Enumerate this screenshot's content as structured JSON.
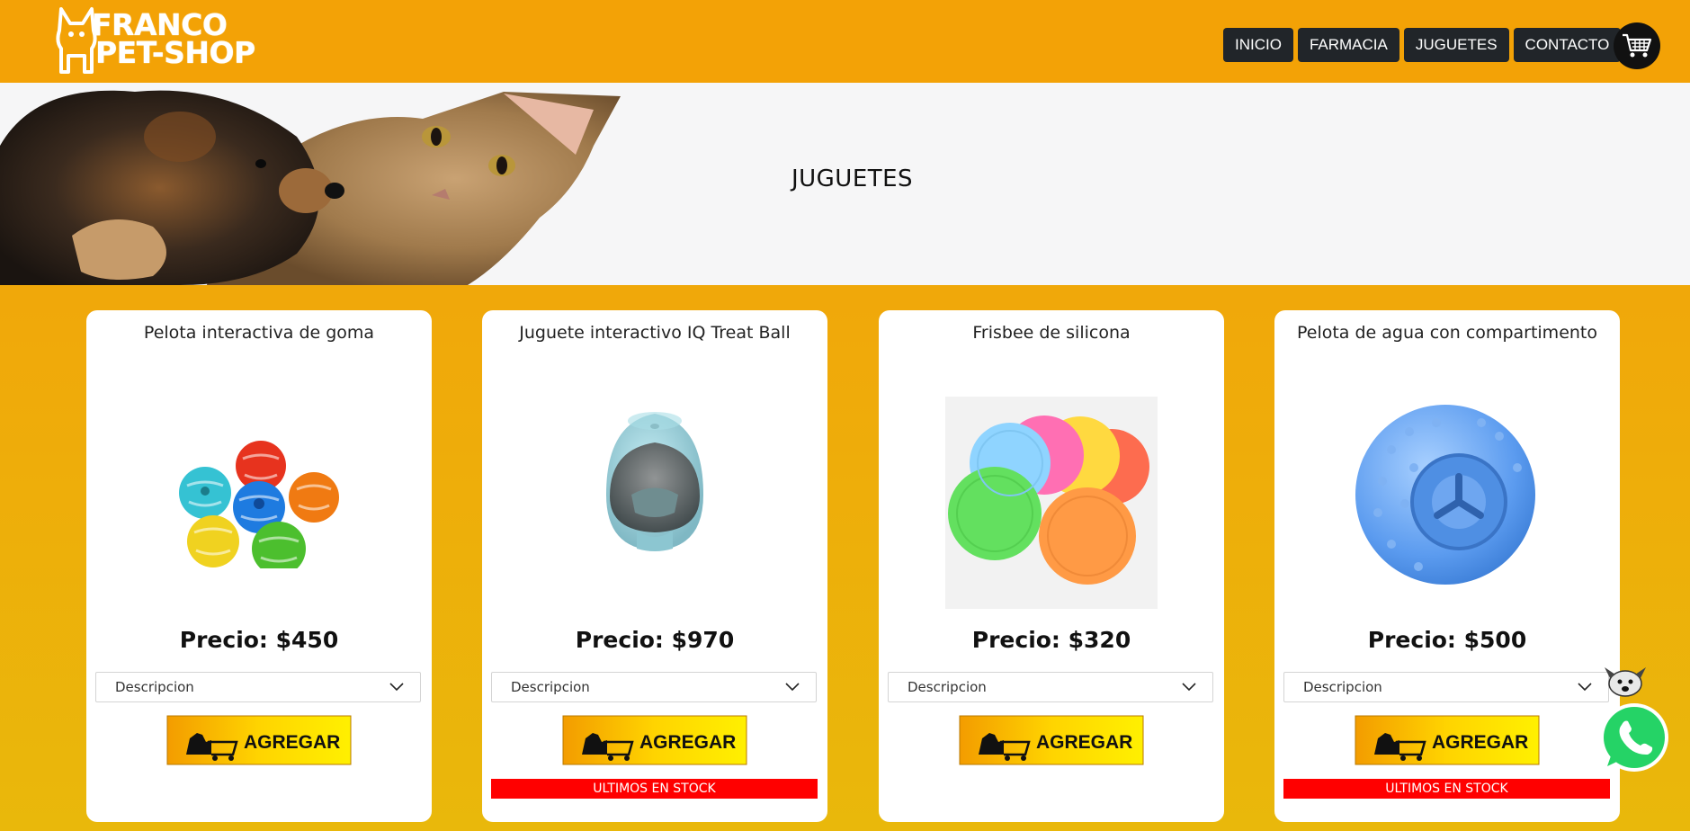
{
  "brand": {
    "line1": "FRANCO",
    "line2": "PET-SHOP"
  },
  "nav": [
    {
      "label": "INICIO"
    },
    {
      "label": "FARMACIA"
    },
    {
      "label": "JUGUETES"
    },
    {
      "label": "CONTACTO"
    }
  ],
  "hero": {
    "title": "JUGUETES"
  },
  "products": [
    {
      "title": "Pelota interactiva de goma",
      "price": "Precio: $450",
      "description": "Descripcion",
      "add_label": "AGREGAR",
      "stock": ""
    },
    {
      "title": "Juguete interactivo IQ Treat Ball",
      "price": "Precio: $970",
      "description": "Descripcion",
      "add_label": "AGREGAR",
      "stock": "ULTIMOS EN STOCK"
    },
    {
      "title": "Frisbee de silicona",
      "price": "Precio: $320",
      "description": "Descripcion",
      "add_label": "AGREGAR",
      "stock": ""
    },
    {
      "title": "Pelota de agua con compartimento",
      "price": "Precio: $500",
      "description": "Descripcion",
      "add_label": "AGREGAR",
      "stock": "ULTIMOS EN STOCK"
    }
  ],
  "colors": {
    "header": "#f3a206",
    "nav_button": "#212529",
    "stock_banner": "#ff0000",
    "add_button": "#ffd400",
    "whatsapp": "#25d366"
  },
  "icons": [
    "cart-icon",
    "chevron-down-icon",
    "whatsapp-icon",
    "dog-cart-icon"
  ]
}
